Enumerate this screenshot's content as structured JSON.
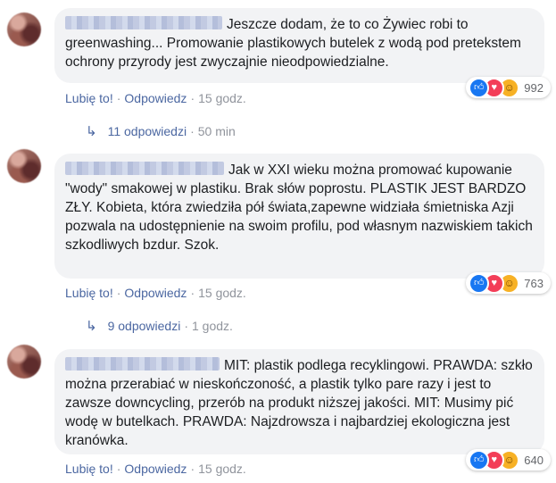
{
  "comments": [
    {
      "text": "Jeszcze dodam, że to co Żywiec robi to greenwashing... Promowanie plastikowych butelek z wodą pod pretekstem ochrony przyrody jest zwyczajnie nieodpowiedzialne.",
      "like_label": "Lubię to!",
      "reply_label": "Odpowiedz",
      "time": "15 godz.",
      "reaction_icons": [
        "like-icon",
        "love-icon",
        "haha-icon"
      ],
      "reaction_count": "992",
      "replies_label": "11 odpowiedzi",
      "replies_time": "50 min"
    },
    {
      "text": "Jak w XXI wieku można promować kupowanie \"wody\" smakowej w plastiku. Brak słów poprostu. PLASTIK JEST BARDZO ZŁY. Kobieta, która zwiedziła pół świata,zapewne widziała śmietniska Azji pozwala na udostępnienie na swoim profilu, pod własnym nazwiskiem takich szkodliwych bzdur. Szok.",
      "like_label": "Lubię to!",
      "reply_label": "Odpowiedz",
      "time": "15 godz.",
      "reaction_icons": [
        "like-icon",
        "love-icon",
        "haha-icon"
      ],
      "reaction_count": "763",
      "replies_label": "9 odpowiedzi",
      "replies_time": "1 godz."
    },
    {
      "text": "MIT: plastik podlega recyklingowi. PRAWDA: szkło można przerabiać w nieskończoność, a plastik tylko pare razy i jest to zawsze downcycling, przerób na produkt niższej jakości. MIT: Musimy pić wodę w butelkach. PRAWDA: Najzdrowsza i najbardziej ekologiczna jest kranówka.",
      "like_label": "Lubię to!",
      "reply_label": "Odpowiedz",
      "time": "15 godz.",
      "reaction_icons": [
        "like-icon",
        "love-icon",
        "haha-icon"
      ],
      "reaction_count": "640"
    }
  ],
  "colors": {
    "link": "#4b67a1",
    "meta": "#90949c",
    "bubble": "#f2f3f5",
    "like": "#1877f2",
    "love": "#f33e58",
    "haha": "#f7b125"
  }
}
